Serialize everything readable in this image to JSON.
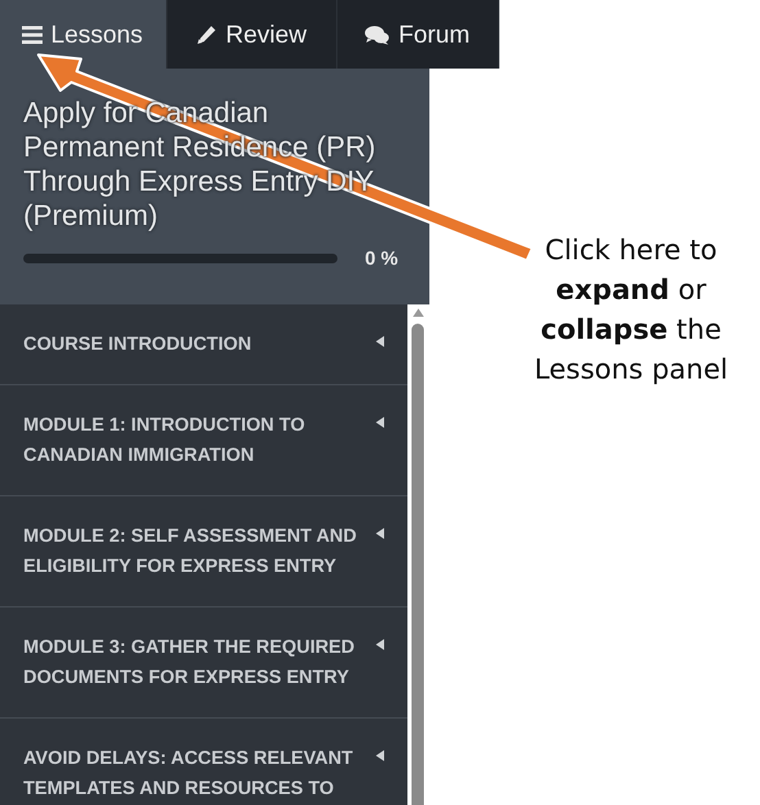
{
  "tabs": [
    {
      "label": "Lessons",
      "selected": true
    },
    {
      "label": "Review",
      "selected": false
    },
    {
      "label": "Forum",
      "selected": false
    }
  ],
  "course": {
    "title": "Apply for Canadian Permanent Residence (PR) Through Express Entry DIY (Premium)",
    "progress": {
      "level": 0,
      "reading": "0 %"
    }
  },
  "lessons": [
    {
      "label": "COURSE INTRODUCTION",
      "expanded": false
    },
    {
      "label": "MODULE 1: INTRODUCTION TO CANADIAN IMMIGRATION",
      "expanded": false
    },
    {
      "label": "MODULE 2: SELF ASSESSMENT AND ELIGIBILITY FOR EXPRESS ENTRY",
      "expanded": false
    },
    {
      "label": "MODULE 3: GATHER THE REQUIRED DOCUMENTS FOR EXPRESS ENTRY",
      "expanded": false
    },
    {
      "label": "AVOID DELAYS: ACCESS RELEVANT TEMPLATES AND RESOURCES TO",
      "expanded": false
    }
  ],
  "annotation": {
    "text": "Click here to **expand** or **collapse** the Lessons panel"
  }
}
